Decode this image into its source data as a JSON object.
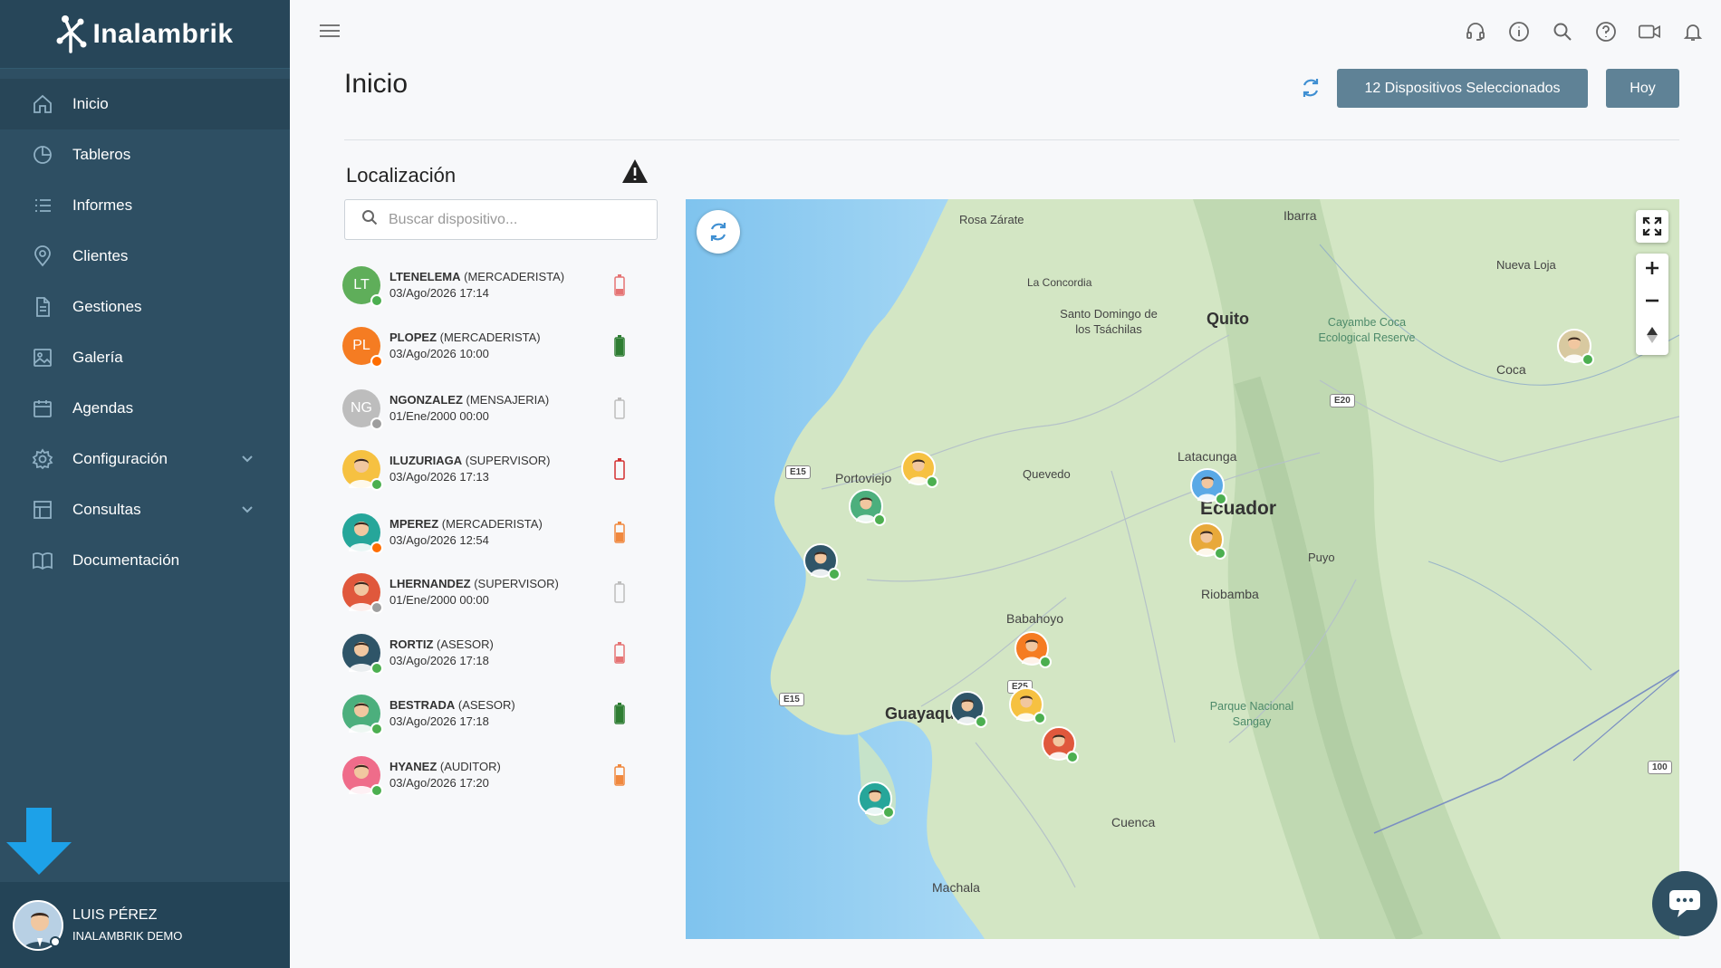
{
  "app": {
    "brand": "Inalambrik"
  },
  "sidebar": {
    "items": [
      {
        "label": "Inicio",
        "icon": "home-icon"
      },
      {
        "label": "Tableros",
        "icon": "pie-chart-icon"
      },
      {
        "label": "Informes",
        "icon": "list-icon"
      },
      {
        "label": "Clientes",
        "icon": "location-pin-icon"
      },
      {
        "label": "Gestiones",
        "icon": "document-icon"
      },
      {
        "label": "Galería",
        "icon": "image-icon"
      },
      {
        "label": "Agendas",
        "icon": "calendar-icon"
      },
      {
        "label": "Configuración",
        "icon": "gear-icon"
      },
      {
        "label": "Consultas",
        "icon": "table-icon"
      },
      {
        "label": "Documentación",
        "icon": "book-icon"
      }
    ],
    "user": {
      "name": "LUIS PÉREZ",
      "org": "INALAMBRIK DEMO"
    }
  },
  "header": {
    "title": "Inicio",
    "devices_button": "12 Dispositivos Seleccionados",
    "today_button": "Hoy"
  },
  "location": {
    "title": "Localización",
    "search_placeholder": "Buscar dispositivo...",
    "devices": [
      {
        "initials": "LT",
        "name": "LTENELEMA",
        "role": "(MERCADERISTA)",
        "date": "03/Ago/2026 17:14",
        "avatar_color": "#5fae5a",
        "status_color": "#4caf50",
        "battery": "low",
        "battery_color": "#e57373"
      },
      {
        "initials": "PL",
        "name": "PLOPEZ",
        "role": "(MERCADERISTA)",
        "date": "03/Ago/2026 10:00",
        "avatar_color": "#f57c22",
        "status_color": "#ff6d00",
        "battery": "full",
        "battery_color": "#2e7d32"
      },
      {
        "initials": "NG",
        "name": "NGONZALEZ",
        "role": "(MENSAJERIA)",
        "date": "01/Ene/2000 00:00",
        "avatar_color": "#bdbdbd",
        "status_color": "#9e9e9e",
        "battery": "empty",
        "battery_color": "#bdbdbd"
      },
      {
        "initials": "",
        "name": "ILUZURIAGA",
        "role": "(SUPERVISOR)",
        "date": "03/Ago/2026 17:13",
        "avatar_color": "#f6c141",
        "status_color": "#4caf50",
        "battery": "critical",
        "battery_color": "#d32f2f"
      },
      {
        "initials": "",
        "name": "MPEREZ",
        "role": "(MERCADERISTA)",
        "date": "03/Ago/2026 12:54",
        "avatar_color": "#26a69a",
        "status_color": "#ff6d00",
        "battery": "half",
        "battery_color": "#f0883e"
      },
      {
        "initials": "",
        "name": "LHERNANDEZ",
        "role": "(SUPERVISOR)",
        "date": "01/Ene/2000 00:00",
        "avatar_color": "#e0583c",
        "status_color": "#9e9e9e",
        "battery": "empty",
        "battery_color": "#bdbdbd"
      },
      {
        "initials": "",
        "name": "RORTIZ",
        "role": "(ASESOR)",
        "date": "03/Ago/2026 17:18",
        "avatar_color": "#2f5568",
        "status_color": "#4caf50",
        "battery": "low",
        "battery_color": "#e57373"
      },
      {
        "initials": "",
        "name": "BESTRADA",
        "role": "(ASESOR)",
        "date": "03/Ago/2026 17:18",
        "avatar_color": "#4caf7d",
        "status_color": "#4caf50",
        "battery": "full",
        "battery_color": "#2e7d32"
      },
      {
        "initials": "",
        "name": "HYANEZ",
        "role": "(AUDITOR)",
        "date": "03/Ago/2026 17:20",
        "avatar_color": "#ef6c8a",
        "status_color": "#4caf50",
        "battery": "half",
        "battery_color": "#f0883e"
      }
    ]
  },
  "map": {
    "labels": [
      "Rosa Zárate",
      "Ibarra",
      "Nueva Loja",
      "La Concordia",
      "Santo Domingo de los Tsáchilas",
      "Quito",
      "Cayambe Coca Ecological Reserve",
      "Coca",
      "Portoviejo",
      "Quevedo",
      "Latacunga",
      "Ecuador",
      "Riobamba",
      "Puyo",
      "Babahoyo",
      "Guayaquil",
      "Parque Nacional Sangay",
      "Cuenca",
      "Machala"
    ],
    "roads": [
      "E15",
      "E15",
      "E20",
      "E25",
      "100"
    ],
    "pin_colors": [
      "#f6c141",
      "#4caf7d",
      "#2f5568",
      "#5aa9e6",
      "#e8a93a",
      "#f57c22",
      "#2f5568",
      "#f6c141",
      "#e0583c",
      "#26a69a",
      "#ef6c8a",
      "#d8c9a0"
    ]
  }
}
